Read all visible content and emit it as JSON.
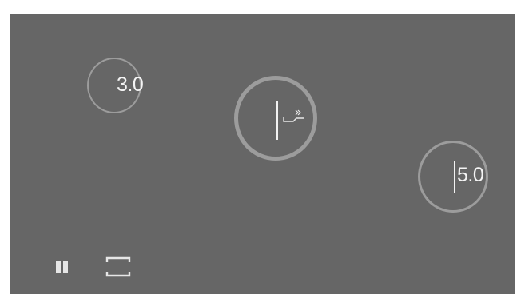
{
  "player": {
    "knob_left_value": "3.0",
    "knob_right_value": "5.0",
    "center_knob_icon": "return-arrow-icon"
  },
  "controls": {
    "pause_icon": "pause-icon",
    "fullscreen_icon": "fullscreen-icon"
  },
  "colors": {
    "background": "#666666",
    "ring": "#afafaf",
    "text": "#f4f4f4"
  }
}
